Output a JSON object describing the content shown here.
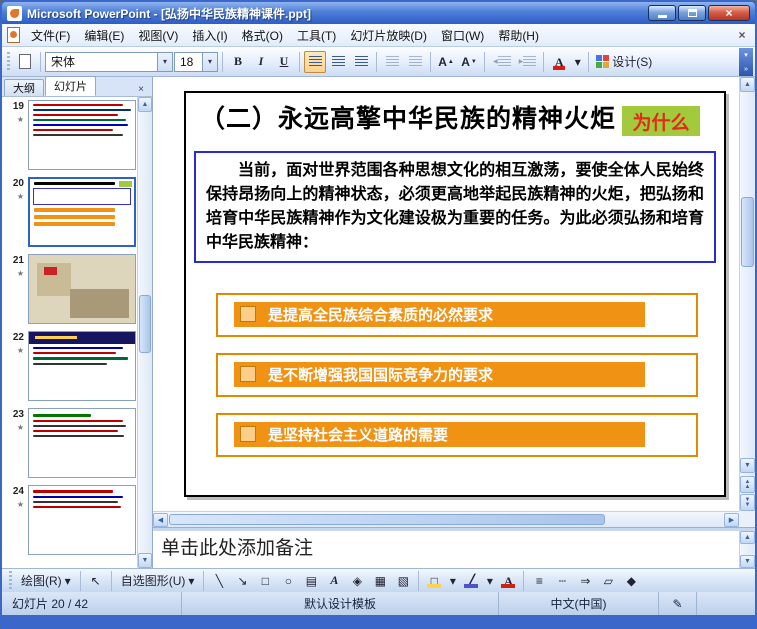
{
  "window": {
    "title": "Microsoft PowerPoint - [弘扬中华民族精神课件.ppt]"
  },
  "icons": {
    "close": "×",
    "menu_close": "×",
    "dropdown": "▾",
    "up": "▲",
    "down": "▼",
    "left": "◀",
    "right": "▶",
    "star": "★",
    "pointer": "↖",
    "line": "╲",
    "arrow": "↘",
    "rect": "□",
    "oval": "○",
    "textbox": "▤",
    "wordart": "A",
    "diagram": "◈",
    "clipart": "▦",
    "picture": "▧",
    "line_brush": "╱",
    "font_letter": "A",
    "line_style": "≡",
    "dash_style": "┄",
    "arrow_style": "⇒",
    "shadow": "▱",
    "threed": "◆",
    "spell": "✎",
    "chevron": "»"
  },
  "menu": {
    "items": [
      "文件(F)",
      "编辑(E)",
      "视图(V)",
      "插入(I)",
      "格式(O)",
      "工具(T)",
      "幻灯片放映(D)",
      "窗口(W)",
      "帮助(H)"
    ]
  },
  "toolbar": {
    "font": "宋体",
    "size": "18",
    "bold": "B",
    "italic": "I",
    "underline": "U",
    "grow": "A",
    "shrink": "A",
    "color_letter": "A",
    "design": "设计(S)"
  },
  "pane": {
    "tabs": [
      "大纲",
      "幻灯片"
    ]
  },
  "thumbnails": {
    "items": [
      {
        "number": "19"
      },
      {
        "number": "20"
      },
      {
        "number": "21"
      },
      {
        "number": "22"
      },
      {
        "number": "23"
      },
      {
        "number": "24"
      }
    ]
  },
  "slide": {
    "title": "（二）永远高擎中华民族的精神火炬",
    "badge": "为什么",
    "body": "当前，面对世界范围各种思想文化的相互激荡，要使全体人民始终保持昂扬向上的精神状态，必须更高地举起民族精神的火炬，把弘扬和培育中华民族精神作为文化建设极为重要的任务。为此必须弘扬和培育中华民族精神：",
    "points": [
      "是提高全民族综合素质的必然要求",
      "是不断增强我国国际竞争力的要求",
      "是坚持社会主义道路的需要"
    ]
  },
  "notes": {
    "placeholder": "单击此处添加备注"
  },
  "drawing": {
    "draw_label": "绘图(R)",
    "autoshapes_label": "自选图形(U)"
  },
  "status": {
    "slide": "幻灯片 20 / 42",
    "template": "默认设计模板",
    "language": "中文(中国)"
  }
}
